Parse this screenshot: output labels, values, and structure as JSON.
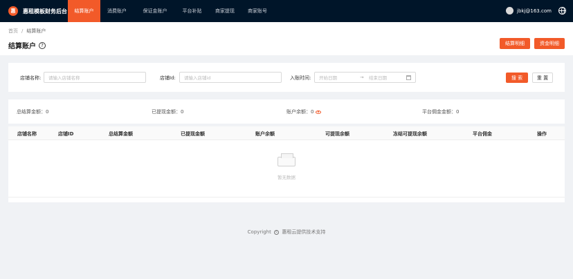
{
  "app": {
    "logo_char": "惠",
    "title": "惠租模板财务后台"
  },
  "nav": [
    {
      "label": "结算账户",
      "active": true
    },
    {
      "label": "消费账户"
    },
    {
      "label": "保证金账户"
    },
    {
      "label": "平台补贴"
    },
    {
      "label": "商家提现"
    },
    {
      "label": "商家账号"
    }
  ],
  "user": {
    "email": "jbkj@163.com"
  },
  "breadcrumb": {
    "home": "首页",
    "sep": "/",
    "current": "结算账户"
  },
  "page": {
    "title": "结算账户",
    "help": "?"
  },
  "actions": {
    "detail": "结算明细",
    "fund": "资金明细"
  },
  "search": {
    "shop_name_label": "店铺名称:",
    "shop_name_placeholder": "请输入店铺名称",
    "shop_id_label": "店铺Id:",
    "shop_id_placeholder": "请输入店铺id",
    "date_label": "入账时间:",
    "start_placeholder": "开始日期",
    "arrow": "→",
    "end_placeholder": "结束日期",
    "search_btn": "搜 索",
    "reset_btn": "重 置"
  },
  "summary": {
    "total": "总结算金额：0",
    "withdrawn": "已提现金额：0",
    "balance": "账户余额：0",
    "commission": "平台佣金金额：0"
  },
  "table": {
    "columns": [
      "店铺名称",
      "店铺ID",
      "总结算金额",
      "已提现金额",
      "账户余额",
      "可提现余额",
      "冻结可提现余额",
      "平台佣金",
      "操作"
    ],
    "empty_text": "暂无数据"
  },
  "footer": {
    "prefix": "Copyright",
    "icon": "c",
    "text": "惠租云提供技术支持"
  },
  "colors": {
    "accent": "#f25a29",
    "nav_bg": "#001529"
  }
}
